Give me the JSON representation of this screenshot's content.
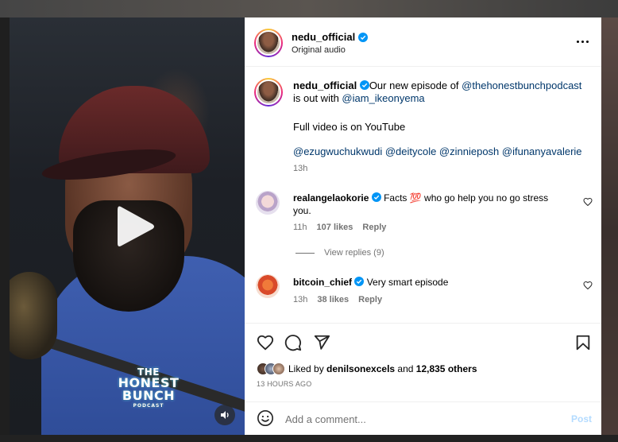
{
  "post": {
    "author": "nedu_official",
    "audio": "Original audio",
    "caption_prefix": "Our new episode of ",
    "caption_mention1": "@thehonestbunchpodcast",
    "caption_mid": " is out with ",
    "caption_mention2": "@iam_ikeonyema",
    "caption_line2": "Full video is on YouTube",
    "caption_tags": "@ezugwuchukwudi @deitycole @zinnieposh @ifunanyavalerie",
    "caption_time": "13h"
  },
  "video": {
    "logo_line1": "THE",
    "logo_line2": "HONEST BUNCH",
    "logo_line3": "PODCAST",
    "play_icon": "play-icon",
    "sound_icon": "volume-icon"
  },
  "comments": [
    {
      "user": "realangelaokorie",
      "text_a": " Facts ",
      "emoji": "💯",
      "text_b": " who go help you no go stress you.",
      "time": "11h",
      "likes": "107 likes",
      "reply": "Reply",
      "view_replies": "View replies (9)"
    },
    {
      "user": "bitcoin_chief",
      "text_a": " Very smart episode",
      "time": "13h",
      "likes": "38 likes",
      "reply": "Reply"
    }
  ],
  "likes": {
    "prefix": "Liked by ",
    "user": "denilsonexcels",
    "middle": " and ",
    "count": "12,835 others",
    "ago": "13 HOURS AGO"
  },
  "composer": {
    "placeholder": "Add a comment...",
    "post_label": "Post"
  },
  "colors": {
    "link": "#00376b",
    "verified": "#0095f6",
    "post_disabled": "#b3dbff",
    "muted": "#737373"
  }
}
